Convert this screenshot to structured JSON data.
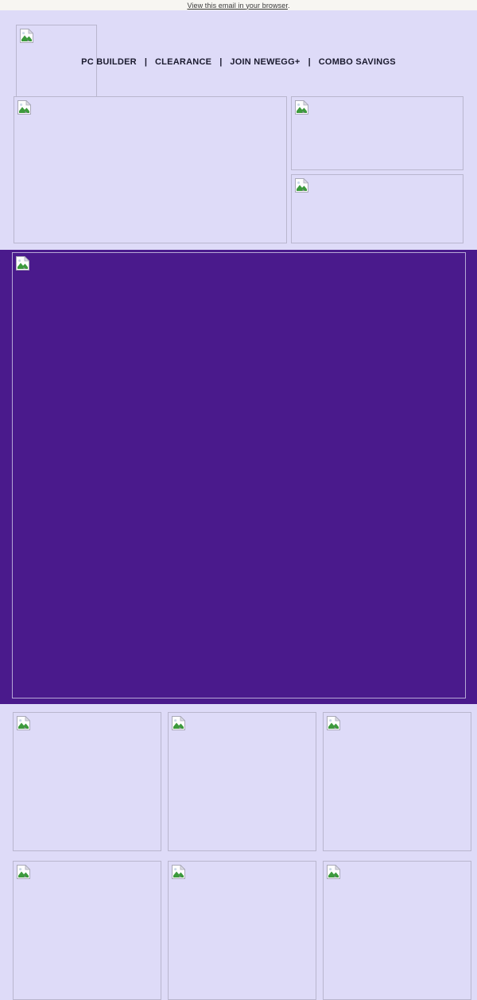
{
  "preheader": {
    "link_text": "View this email in your browser",
    "suffix": "."
  },
  "header": {
    "logo": {
      "alt": "",
      "icon": "broken-image-icon"
    },
    "nav": [
      {
        "label": "PC BUILDER"
      },
      {
        "label": "CLEARANCE"
      },
      {
        "label": "JOIN NEWEGG+"
      },
      {
        "label": "COMBO SAVINGS"
      }
    ],
    "separator": "|"
  },
  "feature_grid": {
    "left": {
      "alt": "",
      "icon": "broken-image-icon"
    },
    "right_top": {
      "alt": "",
      "icon": "broken-image-icon"
    },
    "right_bottom": {
      "alt": "",
      "icon": "broken-image-icon"
    }
  },
  "hero": {
    "alt": "",
    "icon": "broken-image-icon",
    "background_color": "#4A1A8C",
    "border_color": "#B6A8D6"
  },
  "product_grid": {
    "rows": [
      {
        "tiles": [
          {
            "alt": "",
            "icon": "broken-image-icon"
          },
          {
            "alt": "",
            "icon": "broken-image-icon"
          },
          {
            "alt": "",
            "icon": "broken-image-icon"
          }
        ]
      },
      {
        "tiles": [
          {
            "alt": "",
            "icon": "broken-image-icon"
          },
          {
            "alt": "",
            "icon": "broken-image-icon"
          },
          {
            "alt": "",
            "icon": "broken-image-icon"
          }
        ]
      }
    ]
  },
  "colors": {
    "preheader_background": "#F7F6F2",
    "body_background": "#DEDBF8",
    "hero_purple": "#4A1A8C",
    "nav_text": "#1A1A2E",
    "placeholder_border": "#B9B6CE"
  }
}
